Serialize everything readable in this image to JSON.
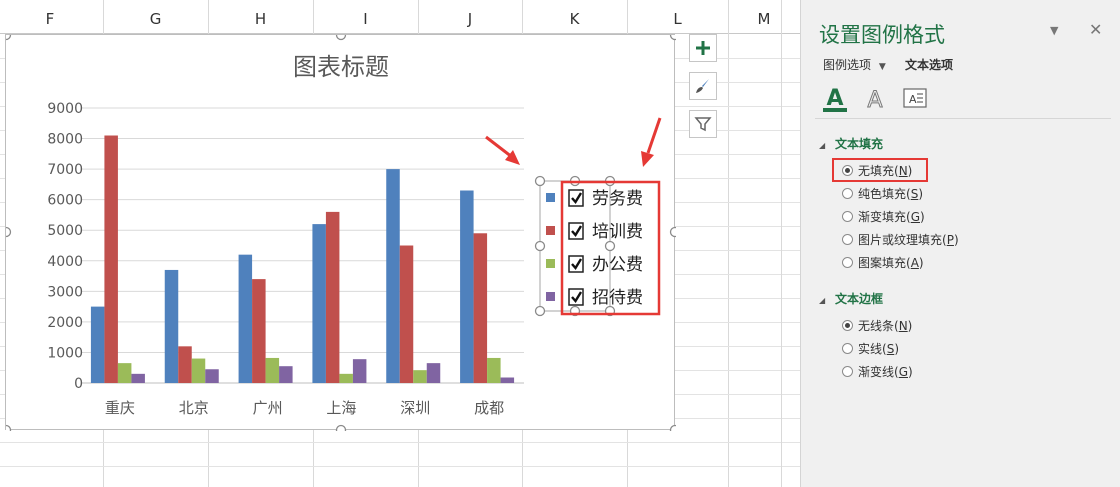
{
  "sheet": {
    "columns": [
      "F",
      "G",
      "H",
      "I",
      "J",
      "K",
      "L",
      "M"
    ]
  },
  "chart_data": {
    "type": "bar",
    "title": "图表标题",
    "categories": [
      "重庆",
      "北京",
      "广州",
      "上海",
      "深圳",
      "成都"
    ],
    "series": [
      {
        "name": "劳务费",
        "color": "#4f81bd",
        "values": [
          2500,
          3700,
          4200,
          5200,
          7000,
          6300
        ]
      },
      {
        "name": "培训费",
        "color": "#c0504d",
        "values": [
          8100,
          1200,
          3400,
          5600,
          4500,
          4900
        ]
      },
      {
        "name": "办公费",
        "color": "#9bbb59",
        "values": [
          650,
          800,
          820,
          300,
          420,
          820
        ]
      },
      {
        "name": "招待费",
        "color": "#8064a2",
        "values": [
          300,
          450,
          550,
          780,
          650,
          180
        ]
      }
    ],
    "yticks": [
      0,
      1000,
      2000,
      3000,
      4000,
      5000,
      6000,
      7000,
      8000,
      9000
    ],
    "ylim": [
      0,
      9000
    ],
    "grid": true,
    "legend": "right",
    "legend_checkboxes": true
  },
  "chart_buttons": [
    {
      "name": "chart-elements-button",
      "icon": "plus-icon"
    },
    {
      "name": "chart-styles-button",
      "icon": "brush-icon"
    },
    {
      "name": "chart-filters-button",
      "icon": "filter-icon"
    }
  ],
  "pane": {
    "title": "设置图例格式",
    "tabs": {
      "legend_options": "图例选项",
      "text_options": "文本选项"
    },
    "sections": {
      "text_fill": {
        "title": "文本填充",
        "options": [
          {
            "label": "无填充",
            "key": "N",
            "checked": true
          },
          {
            "label": "纯色填充",
            "key": "S",
            "checked": false
          },
          {
            "label": "渐变填充",
            "key": "G",
            "checked": false
          },
          {
            "label": "图片或纹理填充",
            "key": "P",
            "checked": false
          },
          {
            "label": "图案填充",
            "key": "A",
            "checked": false
          }
        ]
      },
      "text_border": {
        "title": "文本边框",
        "options": [
          {
            "label": "无线条",
            "key": "N",
            "checked": true
          },
          {
            "label": "实线",
            "key": "S",
            "checked": false
          },
          {
            "label": "渐变线",
            "key": "G",
            "checked": false
          }
        ]
      }
    }
  },
  "colors": {
    "accent": "#217346",
    "annotation": "#e53935"
  }
}
